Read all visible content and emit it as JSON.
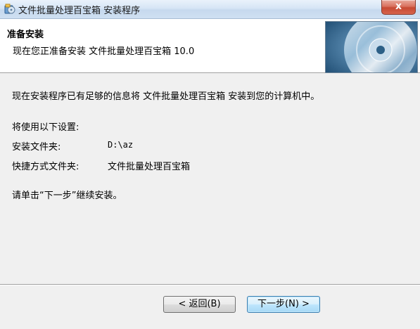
{
  "window": {
    "title": "文件批量处理百宝箱 安装程序",
    "close_label": "x"
  },
  "header": {
    "title": "准备安装",
    "subtitle": "现在您正准备安装 文件批量处理百宝箱 10.0"
  },
  "content": {
    "intro": "现在安装程序已有足够的信息将 文件批量处理百宝箱 安装到您的计算机中。",
    "settings_heading": "将使用以下设置:",
    "install_folder_label": "安装文件夹:",
    "install_folder_value": "D:\\az",
    "shortcut_folder_label": "快捷方式文件夹:",
    "shortcut_folder_value": "文件批量处理百宝箱",
    "instruction": "请单击“下一步”继续安装。"
  },
  "buttons": {
    "back_label": "< 返回(B)",
    "next_label": "下一步(N) >"
  },
  "icons": {
    "app": "installer-app-icon",
    "close": "close-icon",
    "header": "cd-disc-image"
  },
  "colors": {
    "titlebar": "#d6e5f5",
    "close_button": "#c74a33",
    "header_bg": "#ffffff",
    "window_bg": "#f0f0f0"
  }
}
